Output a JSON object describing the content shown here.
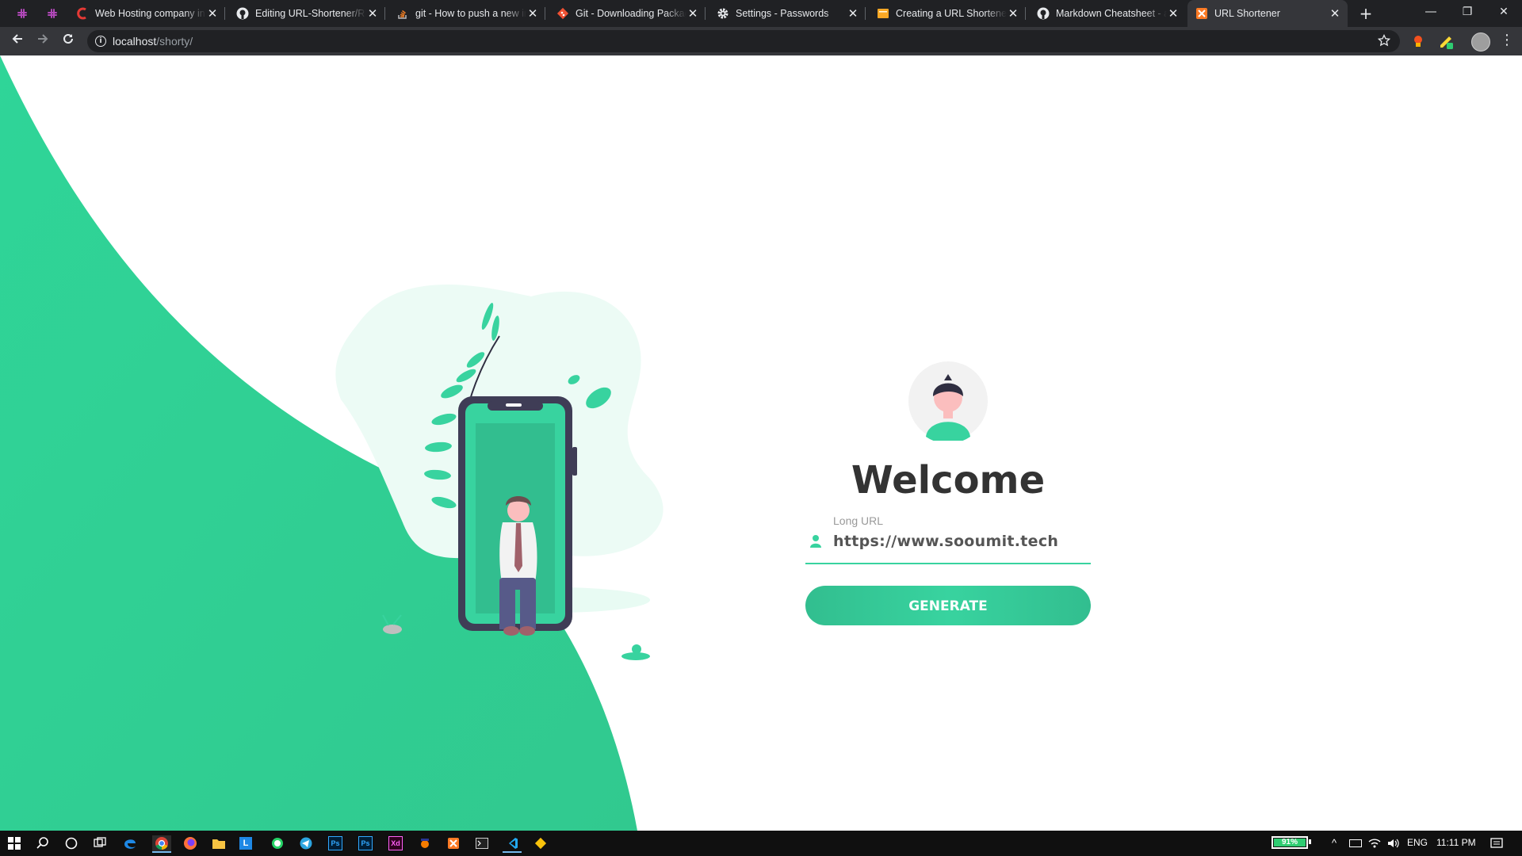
{
  "browser": {
    "tabs": [
      {
        "label": "",
        "icon": "slack-icon"
      },
      {
        "label": "",
        "icon": "slack-icon"
      },
      {
        "label": "Web Hosting company in India",
        "icon": "hosting-icon"
      },
      {
        "label": "Editing URL-Shortener/README",
        "icon": "github-icon"
      },
      {
        "label": "git - How to push a new initial",
        "icon": "stackoverflow-icon"
      },
      {
        "label": "Git - Downloading Package",
        "icon": "git-icon"
      },
      {
        "label": "Settings - Passwords",
        "icon": "gear-icon"
      },
      {
        "label": "Creating a URL Shortener",
        "icon": "doc-icon"
      },
      {
        "label": "Markdown Cheatsheet - adam-p",
        "icon": "github-icon"
      },
      {
        "label": "URL Shortener",
        "icon": "xampp-icon",
        "active": true
      }
    ],
    "address": {
      "host": "localhost",
      "path": "/shorty/"
    }
  },
  "page": {
    "heading": "Welcome",
    "form": {
      "label": "Long URL",
      "value": "https://www.sooumit.tech",
      "button": "GENERATE"
    },
    "colors": {
      "accent": "#38d39f",
      "accent_dark": "#32be8f",
      "heading": "#333333"
    }
  },
  "taskbar": {
    "battery": "91%",
    "language": "ENG",
    "time": "11:11 PM"
  }
}
